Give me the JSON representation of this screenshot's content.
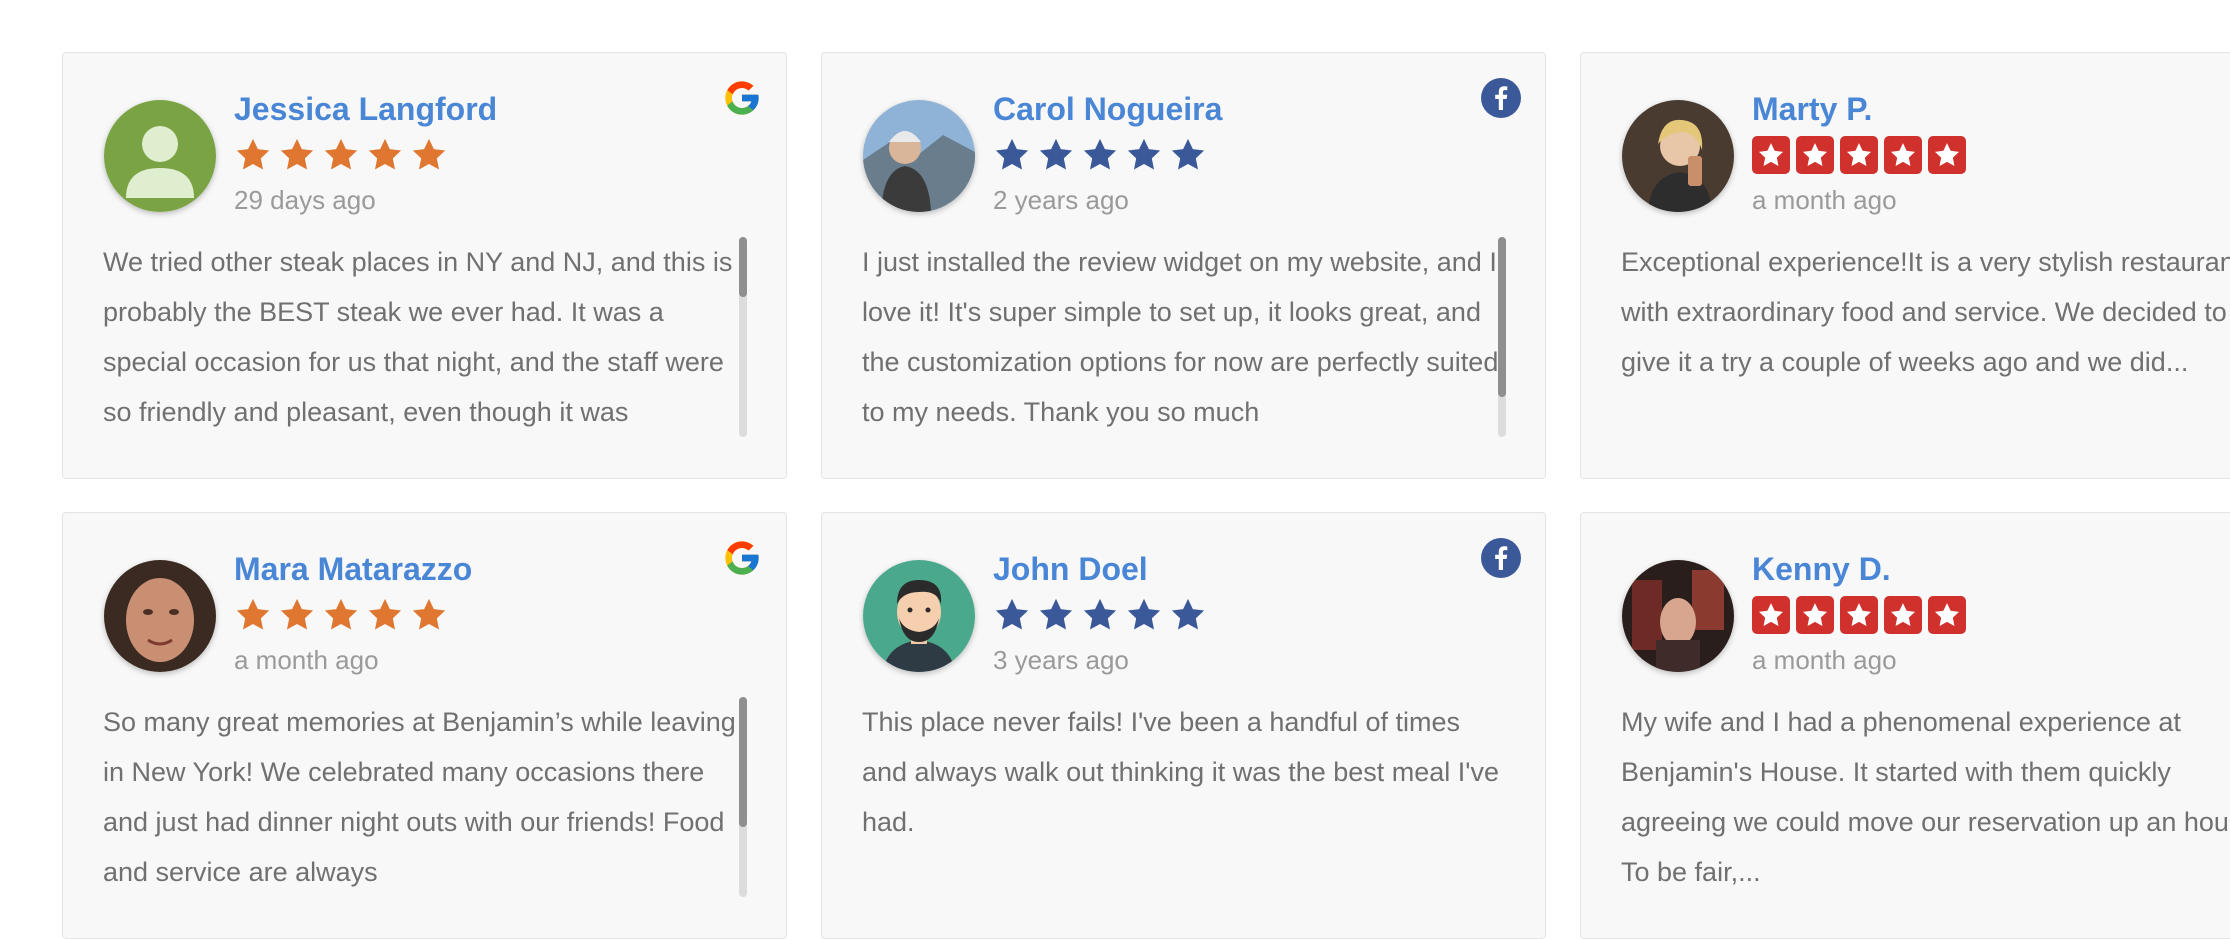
{
  "colors": {
    "name": "#4a86d6",
    "google_star": "#e07730",
    "facebook_star": "#3b5998",
    "yelp_star_bg": "#d0312d",
    "date": "#9a9a9a",
    "text": "#707070"
  },
  "reviews": [
    {
      "name": "Jessica Langford",
      "date": "29 days ago",
      "rating": 5,
      "source": "google",
      "source_icon": "google-icon",
      "avatar": "default-user-avatar",
      "text": "We tried other steak places in NY and NJ, and this is probably the BEST steak we ever had. It was a special occasion for us that night, and the staff were so friendly and pleasant, even though it was",
      "scroll_position": 0.0,
      "scroll_visible_fraction": 0.3
    },
    {
      "name": "Carol Nogueira",
      "date": "2 years ago",
      "rating": 5,
      "source": "facebook",
      "source_icon": "facebook-icon",
      "avatar": "photo-avatar",
      "text": "I just installed the review widget on my website, and I love it! It's super simple to set up, it looks great, and the customization options for now are perfectly suited to my needs. Thank you so much",
      "scroll_position": 0.0,
      "scroll_visible_fraction": 0.8
    },
    {
      "name": "Marty P.",
      "date": "a month ago",
      "rating": 5,
      "source": "yelp",
      "source_icon": "",
      "avatar": "photo-avatar",
      "text": "Exceptional experience!It is a very stylish restaurant with extraordinary food and service. We decided to give it a try a couple of weeks ago and we did...",
      "scroll_position": null,
      "scroll_visible_fraction": null
    },
    {
      "name": "Mara Matarazzo",
      "date": "a month ago",
      "rating": 5,
      "source": "google",
      "source_icon": "google-icon",
      "avatar": "photo-avatar",
      "text": "So many great memories at Benjamin’s while leaving in New York! We celebrated many occasions there and just had dinner night outs with our friends! Food and service are always",
      "scroll_position": 0.0,
      "scroll_visible_fraction": 0.65
    },
    {
      "name": "John Doel",
      "date": "3 years ago",
      "rating": 5,
      "source": "facebook",
      "source_icon": "facebook-icon",
      "avatar": "cartoon-man-avatar",
      "text": "This place never fails! I've been a handful of times and always walk out thinking it was the best meal I've had.",
      "scroll_position": null,
      "scroll_visible_fraction": null
    },
    {
      "name": "Kenny D.",
      "date": "a month ago",
      "rating": 5,
      "source": "yelp",
      "source_icon": "",
      "avatar": "photo-avatar",
      "text": "My wife and I had a phenomenal experience at Benjamin's House. It started with them quickly agreeing we could move our reservation up an hour. To be fair,...",
      "scroll_position": null,
      "scroll_visible_fraction": null
    }
  ]
}
